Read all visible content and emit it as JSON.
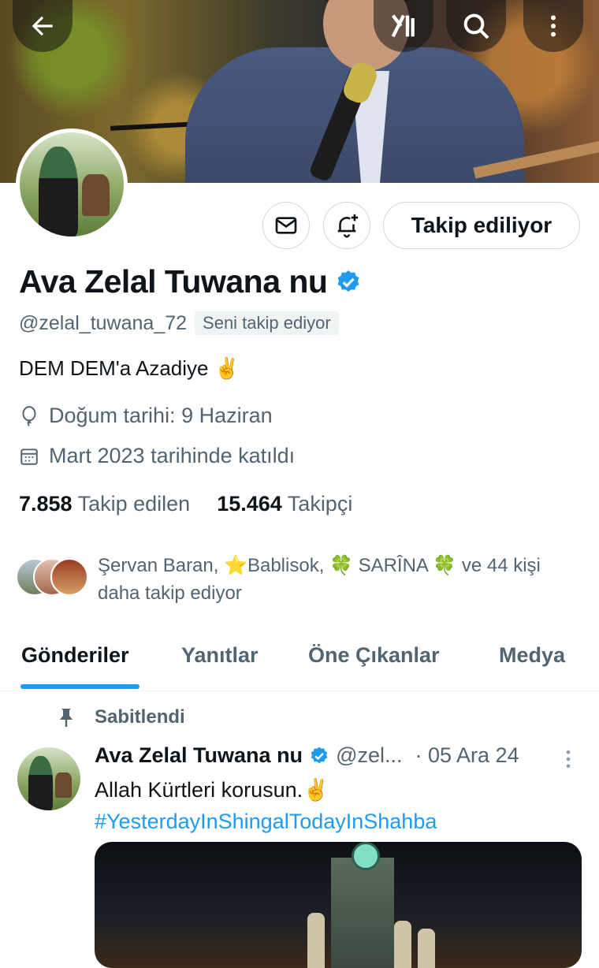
{
  "header": {
    "back_icon": "arrow-left-icon",
    "grok_icon": "grok-icon",
    "search_icon": "search-icon",
    "more_icon": "more-vertical-icon"
  },
  "profile": {
    "name": "Ava Zelal Tuwana nu",
    "verified": true,
    "handle": "@zelal_tuwana_72",
    "follows_you": "Seni takip ediyor",
    "bio": "DEM DEM'a Azadiye ✌️",
    "birthday": "Doğum tarihi: 9 Haziran",
    "joined": "Mart 2023 tarihinde katıldı",
    "following_count": "7.858",
    "following_label": "Takip edilen",
    "followers_count": "15.464",
    "followers_label": "Takipçi",
    "mutual_line1": "Şervan Baran, ⭐Bablisok, 🍀 SARÎNA 🍀 ve 44 kişi",
    "mutual_line2": "daha takip ediyor"
  },
  "actions": {
    "message_icon": "envelope-icon",
    "notify_icon": "bell-plus-icon",
    "follow_label": "Takip ediliyor"
  },
  "tabs": [
    {
      "label": "Gönderiler",
      "active": true
    },
    {
      "label": "Yanıtlar",
      "active": false
    },
    {
      "label": "Öne Çıkanlar",
      "active": false
    },
    {
      "label": "Medya",
      "active": false
    }
  ],
  "post": {
    "pinned_label": "Sabitlendi",
    "author": "Ava Zelal Tuwana nu",
    "handle": "@zel...",
    "date": "· 05 Ara 24",
    "text": "Allah Kürtleri korusun.✌️",
    "hashtag": "#YesterdayInShingalTodayInShahba"
  },
  "colors": {
    "accent": "#1d9bf0",
    "muted": "#536471",
    "text": "#0f1419"
  }
}
